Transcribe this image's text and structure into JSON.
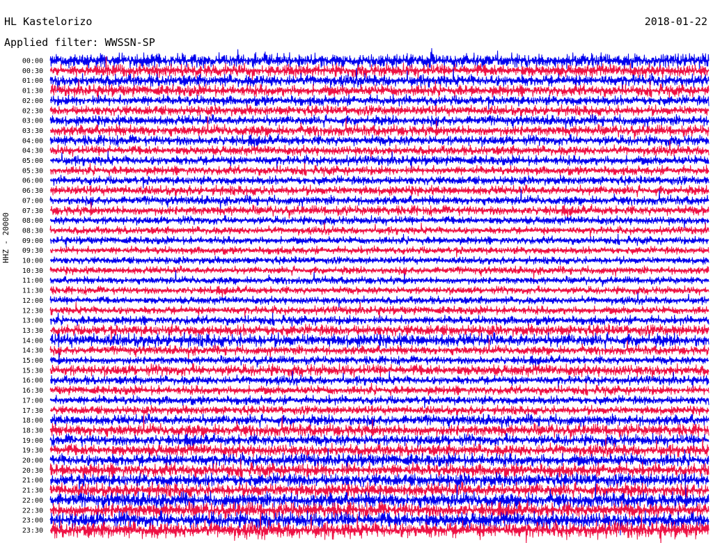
{
  "header": {
    "station": "HL Kastelorizo",
    "date": "2018-01-22",
    "filter_label": "Applied filter: WWSSN-SP"
  },
  "chart_data": {
    "type": "line",
    "title": "HL Kastelorizo",
    "subtitle": "Applied filter: WWSSN-SP",
    "date": "2018-01-22",
    "ylabel": "HHZ - 20000",
    "xlabel": "",
    "grid": false,
    "legend": "none",
    "colors": {
      "blue": "#0000ee",
      "red": "#ee1144"
    },
    "series_color_cycle": [
      "blue",
      "red"
    ],
    "rows": [
      {
        "time": "00:00",
        "color": "blue",
        "activity": 0.8
      },
      {
        "time": "00:30",
        "color": "red",
        "activity": 0.7
      },
      {
        "time": "01:00",
        "color": "blue",
        "activity": 0.65
      },
      {
        "time": "01:30",
        "color": "red",
        "activity": 0.6
      },
      {
        "time": "02:00",
        "color": "blue",
        "activity": 0.5
      },
      {
        "time": "02:30",
        "color": "red",
        "activity": 0.5
      },
      {
        "time": "03:00",
        "color": "blue",
        "activity": 0.5
      },
      {
        "time": "03:30",
        "color": "red",
        "activity": 0.55
      },
      {
        "time": "04:00",
        "color": "blue",
        "activity": 0.5
      },
      {
        "time": "04:30",
        "color": "red",
        "activity": 0.45
      },
      {
        "time": "05:00",
        "color": "blue",
        "activity": 0.45
      },
      {
        "time": "05:30",
        "color": "red",
        "activity": 0.4
      },
      {
        "time": "06:00",
        "color": "blue",
        "activity": 0.4
      },
      {
        "time": "06:30",
        "color": "red",
        "activity": 0.45
      },
      {
        "time": "07:00",
        "color": "blue",
        "activity": 0.4
      },
      {
        "time": "07:30",
        "color": "red",
        "activity": 0.45
      },
      {
        "time": "08:00",
        "color": "blue",
        "activity": 0.35
      },
      {
        "time": "08:30",
        "color": "red",
        "activity": 0.3
      },
      {
        "time": "09:00",
        "color": "blue",
        "activity": 0.3
      },
      {
        "time": "09:30",
        "color": "red",
        "activity": 0.3
      },
      {
        "time": "10:00",
        "color": "blue",
        "activity": 0.28
      },
      {
        "time": "10:30",
        "color": "red",
        "activity": 0.3
      },
      {
        "time": "11:00",
        "color": "blue",
        "activity": 0.28
      },
      {
        "time": "11:30",
        "color": "red",
        "activity": 0.3
      },
      {
        "time": "12:00",
        "color": "blue",
        "activity": 0.3
      },
      {
        "time": "12:30",
        "color": "red",
        "activity": 0.35
      },
      {
        "time": "13:00",
        "color": "blue",
        "activity": 0.4
      },
      {
        "time": "13:30",
        "color": "red",
        "activity": 0.6
      },
      {
        "time": "14:00",
        "color": "blue",
        "activity": 0.75
      },
      {
        "time": "14:30",
        "color": "red",
        "activity": 0.4
      },
      {
        "time": "15:00",
        "color": "blue",
        "activity": 0.35
      },
      {
        "time": "15:30",
        "color": "red",
        "activity": 0.6
      },
      {
        "time": "16:00",
        "color": "blue",
        "activity": 0.4
      },
      {
        "time": "16:30",
        "color": "red",
        "activity": 0.4
      },
      {
        "time": "17:00",
        "color": "blue",
        "activity": 0.4
      },
      {
        "time": "17:30",
        "color": "red",
        "activity": 0.4
      },
      {
        "time": "18:00",
        "color": "blue",
        "activity": 0.55
      },
      {
        "time": "18:30",
        "color": "red",
        "activity": 0.65
      },
      {
        "time": "19:00",
        "color": "blue",
        "activity": 0.6
      },
      {
        "time": "19:30",
        "color": "red",
        "activity": 0.65
      },
      {
        "time": "20:00",
        "color": "blue",
        "activity": 0.7
      },
      {
        "time": "20:30",
        "color": "red",
        "activity": 0.75
      },
      {
        "time": "21:00",
        "color": "blue",
        "activity": 0.75
      },
      {
        "time": "21:30",
        "color": "red",
        "activity": 0.8
      },
      {
        "time": "22:00",
        "color": "blue",
        "activity": 0.85
      },
      {
        "time": "22:30",
        "color": "red",
        "activity": 0.9
      },
      {
        "time": "23:00",
        "color": "blue",
        "activity": 0.95
      },
      {
        "time": "23:30",
        "color": "red",
        "activity": 1.0
      }
    ]
  }
}
